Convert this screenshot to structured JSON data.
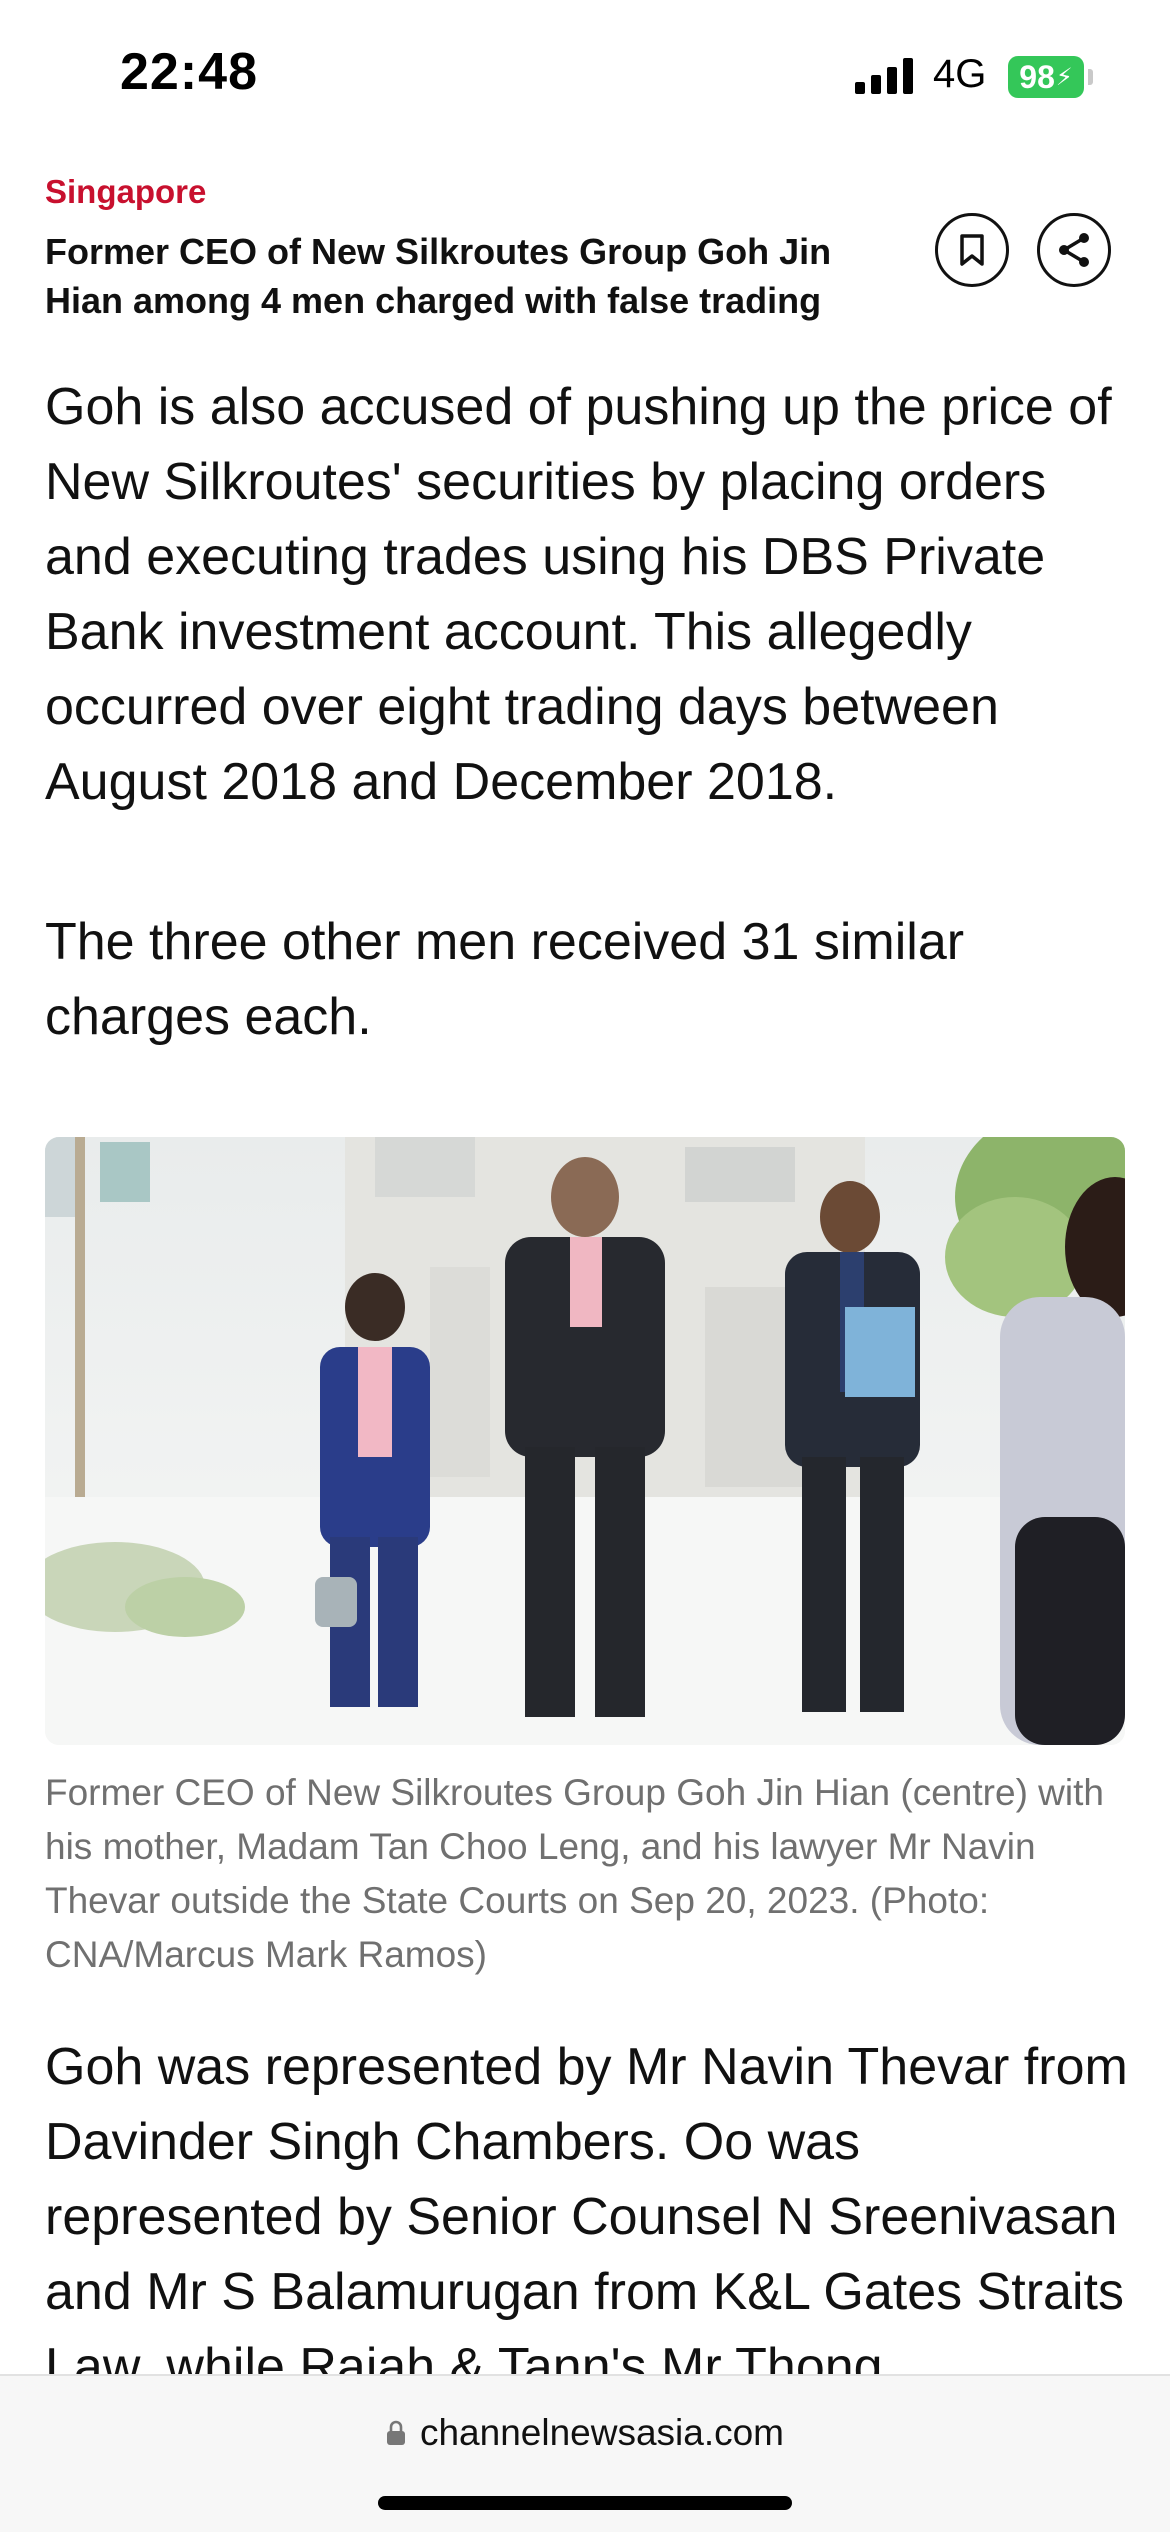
{
  "status_bar": {
    "time": "22:48",
    "network": "4G",
    "battery": "98"
  },
  "article": {
    "section": "Singapore",
    "headline": "Former CEO of New Silkroutes Group Goh Jin Hian among 4 men charged with false trading",
    "paragraphs": [
      "Goh is also accused of pushing up the price of New Silkroutes' securities by placing orders and executing trades using his DBS Private Bank investment account. This allegedly occurred over eight trading days between August 2018 and December 2018.",
      "The three other men received 31 similar charges each.",
      "Goh was represented by Mr Navin Thevar from Davinder Singh Chambers. Oo was represented by Senior Counsel N Sreenivasan and Mr S Balamurugan from K&L Gates Straits Law, while Rajah & Tann's Mr Thong"
    ],
    "photo_caption": "Former CEO of New Silkroutes Group Goh Jin Hian (centre) with his mother, Madam Tan Choo Leng, and his lawyer Mr Navin Thevar outside the State Courts on Sep 20, 2023. (Photo: CNA/Marcus Mark Ramos)"
  },
  "browser": {
    "url": "channelnewsasia.com"
  },
  "colors": {
    "accent": "#c8102e",
    "battery": "#34c759",
    "caption": "#707070"
  },
  "icons": [
    "bookmark-icon",
    "share-icon",
    "lock-icon",
    "signal-icon"
  ]
}
